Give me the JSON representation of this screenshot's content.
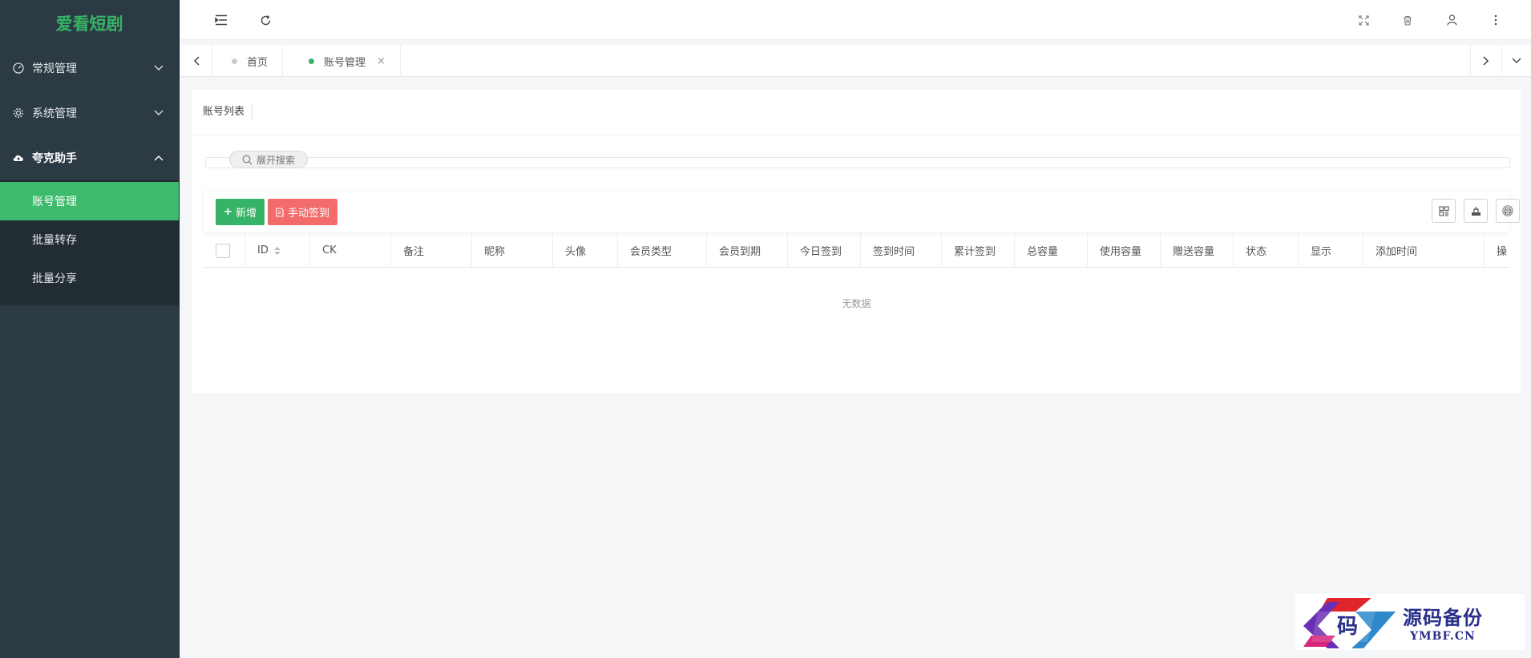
{
  "app": {
    "title": "爱看短剧",
    "brand_color": "#36b366"
  },
  "sidebar": {
    "items": [
      {
        "label": "常规管理",
        "icon": "dashboard-icon",
        "expanded": false
      },
      {
        "label": "系统管理",
        "icon": "gear-icon",
        "expanded": false
      },
      {
        "label": "夸克助手",
        "icon": "cloud-upload-icon",
        "expanded": true,
        "children": [
          {
            "label": "账号管理",
            "active": true
          },
          {
            "label": "批量转存",
            "active": false
          },
          {
            "label": "批量分享",
            "active": false
          }
        ]
      }
    ]
  },
  "tabs": [
    {
      "label": "首页",
      "active": false
    },
    {
      "label": "账号管理",
      "active": true,
      "close": "×"
    }
  ],
  "main": {
    "panel_title": "账号列表",
    "search_label": "展开搜索",
    "toolbar": {
      "add_label": "新增",
      "sign_label": "手动签到",
      "add_color": "#36b366",
      "sign_color": "#f26c6c"
    },
    "table": {
      "columns": [
        "ID",
        "CK",
        "备注",
        "昵称",
        "头像",
        "会员类型",
        "会员到期",
        "今日签到",
        "签到时间",
        "累计签到",
        "总容量",
        "使用容量",
        "赠送容量",
        "状态",
        "显示",
        "添加时间",
        "操"
      ],
      "rows": [],
      "empty_text": "无数据"
    }
  },
  "watermark": {
    "main": "源码备份",
    "sub": "YMBF.CN",
    "logo_char": "码"
  }
}
